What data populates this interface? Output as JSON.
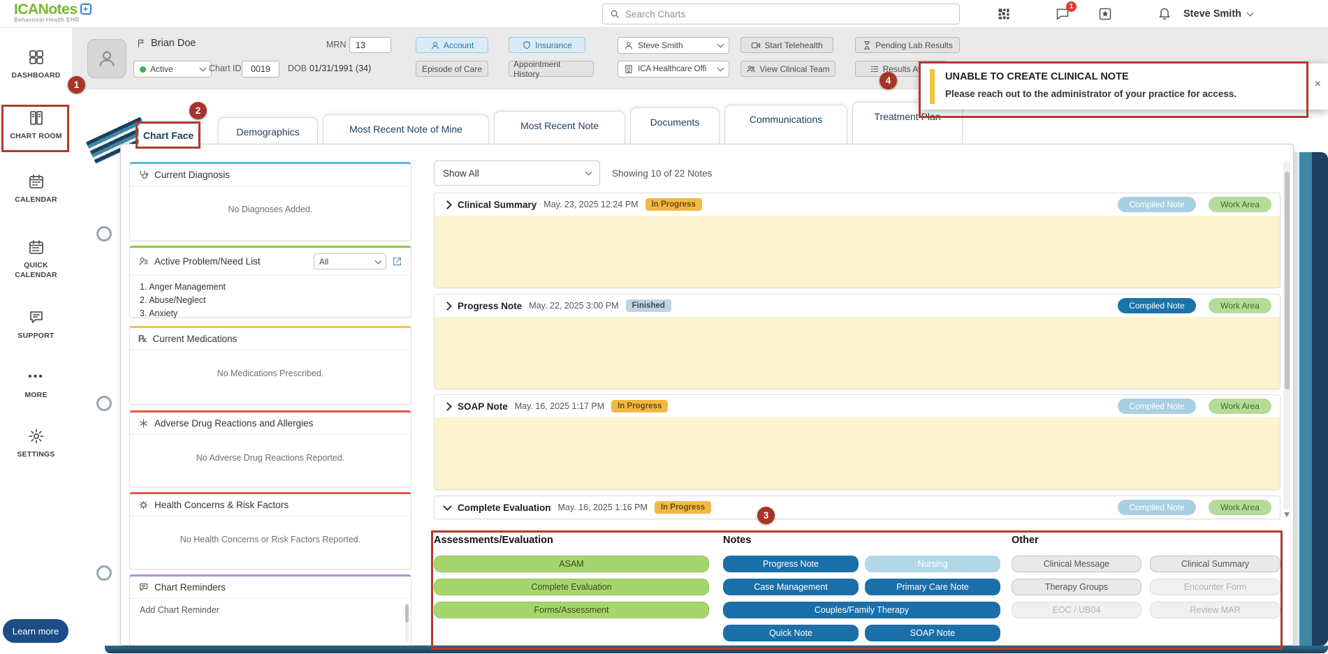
{
  "topbar": {
    "logo_text": "ICANotes",
    "logo_tagline": "Behavioral Health EHR",
    "search_placeholder": "Search Charts",
    "chat_badge": "1",
    "user_name": "Steve Smith"
  },
  "icons": {
    "logo_plus_glyph": "+",
    "more_glyph": "•••",
    "rx_glyph": "℞"
  },
  "sidebar": {
    "items": [
      {
        "label": "DASHBOARD"
      },
      {
        "label": "CHART ROOM"
      },
      {
        "label": "CALENDAR"
      },
      {
        "label": "QUICK CALENDAR"
      },
      {
        "label": "SUPPORT"
      },
      {
        "label": "MORE"
      },
      {
        "label": "SETTINGS"
      }
    ],
    "learn_more_label": "Learn more"
  },
  "patient": {
    "name": "Brian Doe",
    "mrn_label": "MRN",
    "mrn_value": "13",
    "status_value": "Active",
    "chart_id_label": "Chart ID",
    "chart_id_value": "0019",
    "dob_label": "DOB",
    "dob_value": "01/31/1991 (34)",
    "account_label": "Account",
    "insurance_label": "Insurance",
    "episode_of_care_label": "Episode of Care",
    "appointment_history_label": "Appointment History",
    "clinician_value": "Steve Smith",
    "office_value": "ICA Healthcare Offi",
    "start_telehealth_label": "Start Telehealth",
    "view_clinical_team_label": "View Clinical Team",
    "pending_lab_results_label": "Pending Lab Results",
    "results_awaiting_label": "Results Await"
  },
  "notification": {
    "title": "UNABLE TO CREATE CLINICAL NOTE",
    "message": "Please reach out to the administrator of your practice for access.",
    "close_label": "×"
  },
  "tabs": {
    "active_tab": "Chart Face",
    "items": [
      {
        "label": "Demographics"
      },
      {
        "label": "Most Recent Note of Mine"
      },
      {
        "label": "Most Recent Note"
      },
      {
        "label": "Documents"
      },
      {
        "label": "Communications"
      },
      {
        "label": "Treatment Plan"
      }
    ]
  },
  "widgets": [
    {
      "title": "Current Diagnosis",
      "empty_text": "No Diagnoses Added.",
      "accent": "#55b9e5"
    },
    {
      "title": "Active Problem/Need List",
      "filter_value": "All",
      "items": [
        "1. Anger Management",
        "2. Abuse/Neglect",
        "3. Anxiety"
      ],
      "accent": "#8dc63f"
    },
    {
      "title": "Current Medications",
      "empty_text": "No Medications Prescribed.",
      "accent": "#f5c242"
    },
    {
      "title": "Adverse Drug Reactions and Allergies",
      "empty_text": "No Adverse Drug Reactions Reported.",
      "accent": "#e4574b"
    },
    {
      "title": "Health Concerns & Risk Factors",
      "empty_text": "No Health Concerns or Risk Factors Reported.",
      "accent": "#e4574b"
    },
    {
      "title": "Chart Reminders",
      "placeholder": "Add Chart Reminder",
      "accent": "#b48cd9"
    }
  ],
  "notes_panel": {
    "filter_value": "Show All",
    "count_text": "Showing 10 of 22 Notes",
    "compiled_note_label": "Compiled Note",
    "work_area_label": "Work Area",
    "notes": [
      {
        "title": "Clinical Summary",
        "date": "May. 23, 2025 12:24 PM",
        "status": "In Progress",
        "expanded": false,
        "compiled_enabled": false
      },
      {
        "title": "Progress Note",
        "date": "May. 22, 2025 3:00 PM",
        "status": "Finished",
        "expanded": false,
        "compiled_enabled": true
      },
      {
        "title": "SOAP Note",
        "date": "May. 16, 2025 1:17 PM",
        "status": "In Progress",
        "expanded": false,
        "compiled_enabled": false
      },
      {
        "title": "Complete Evaluation",
        "date": "May. 16, 2025 1:16 PM",
        "status": "In Progress",
        "expanded": true,
        "compiled_enabled": false
      }
    ]
  },
  "create_note": {
    "assessments": {
      "title": "Assessments/Evaluation",
      "buttons": [
        {
          "label": "ASAM"
        },
        {
          "label": "Complete Evaluation"
        },
        {
          "label": "Forms/Assessment"
        }
      ]
    },
    "notes": {
      "title": "Notes",
      "buttons": [
        {
          "label": "Progress Note"
        },
        {
          "label": "Nursing"
        },
        {
          "label": "Case Management"
        },
        {
          "label": "Primary Care Note"
        },
        {
          "label": "Couples/Family Therapy"
        },
        {
          "label": "Quick Note"
        },
        {
          "label": "SOAP Note"
        }
      ]
    },
    "other": {
      "title": "Other",
      "buttons": [
        {
          "label": "Clinical Message"
        },
        {
          "label": "Clinical Summary"
        },
        {
          "label": "Therapy Groups"
        },
        {
          "label": "Encounter Form"
        },
        {
          "label": "EOC / UB04"
        },
        {
          "label": "Review MAR"
        }
      ]
    }
  },
  "annotations": {
    "step1": "1",
    "step2": "2",
    "step3": "3",
    "step4": "4"
  },
  "colors": {
    "brand_green": "#76b82a",
    "brand_blue": "#2e7fd1",
    "primary_blue": "#1b6fa8",
    "annotation_red": "#b03a2e",
    "note_body_yellow": "#fcf3cf",
    "in_progress_yellow": "#f3b844",
    "finished_blue": "#c2d2df",
    "work_area_green": "#b4db97",
    "create_button_green": "#a6d56e",
    "nursing_light_blue": "#b2d8e8",
    "active_status_green": "#3cb54a",
    "notification_accent_yellow": "#efc33b"
  }
}
